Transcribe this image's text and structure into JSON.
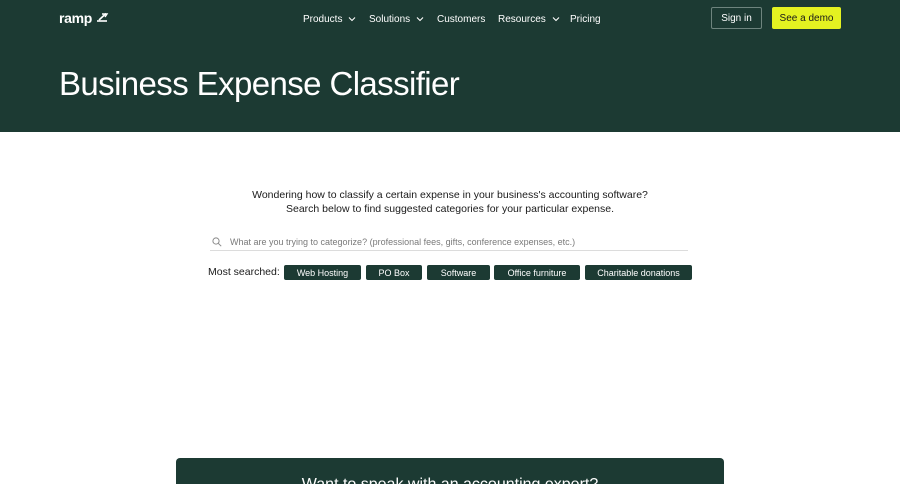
{
  "colors": {
    "brand_dark": "#1c3a33",
    "accent": "#e4f221",
    "text": "#1a1a1a"
  },
  "nav": {
    "logo": "ramp",
    "items": [
      {
        "label": "Products",
        "has_dropdown": true
      },
      {
        "label": "Solutions",
        "has_dropdown": true
      },
      {
        "label": "Customers",
        "has_dropdown": false
      },
      {
        "label": "Resources",
        "has_dropdown": true
      },
      {
        "label": "Pricing",
        "has_dropdown": false
      }
    ],
    "sign_in": "Sign in",
    "demo": "See a demo"
  },
  "hero": {
    "title": "Business Expense Classifier"
  },
  "intro": {
    "line1": "Wondering how to classify a certain expense in your business's accounting software?",
    "line2": "Search below to find suggested categories for your particular expense."
  },
  "search": {
    "placeholder": "What are you trying to categorize? (professional fees, gifts, conference expenses, etc.)",
    "value": "",
    "icon": "search-icon"
  },
  "most_searched": {
    "label": "Most searched:",
    "chips": [
      "Web Hosting",
      "PO Box",
      "Software",
      "Office furniture",
      "Charitable donations"
    ]
  },
  "cta": {
    "title": "Want to speak with an accounting expert?"
  }
}
